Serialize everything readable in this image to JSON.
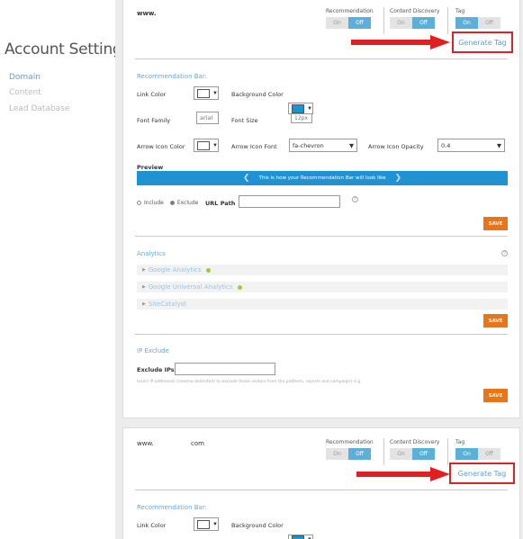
{
  "sidebar": {
    "title": "Account Settings",
    "items": [
      {
        "label": "Domain",
        "active": true
      },
      {
        "label": "Content",
        "active": false
      },
      {
        "label": "Lead Database",
        "active": false
      }
    ]
  },
  "colors": {
    "accent": "#5bb0d9",
    "save": "#e8751a",
    "annotation_red": "#d2242a",
    "preview_bar": "#1f93d1"
  },
  "domains": [
    {
      "name": "www.",
      "toggles": [
        {
          "label": "Recommendation",
          "on": "On",
          "off": "Off",
          "state": "off"
        },
        {
          "label": "Content Discovery",
          "on": "On",
          "off": "Off",
          "state": "off"
        },
        {
          "label": "Tag",
          "on": "On",
          "off": "Off",
          "state": "on"
        }
      ],
      "generate_tag": "Generate Tag",
      "recommendation_bar": {
        "title": "Recommendation Bar:",
        "link_color": "Link Color",
        "background_color": "Background Color",
        "font_family": "Font Family",
        "font_family_value": "arial",
        "font_size": "Font Size",
        "font_size_value": "12px",
        "arrow_icon_color": "Arrow Icon Color",
        "arrow_icon_font": "Arrow Icon Font",
        "arrow_icon_font_value": "fa-chevron",
        "arrow_icon_opacity": "Arrow Icon Opacity",
        "arrow_icon_opacity_value": "0.4",
        "preview": "Preview",
        "preview_text": "This is how your Recommendation Bar will look like",
        "include": "Include",
        "exclude": "Exclude",
        "url_path": "URL Path",
        "save": "SAVE"
      },
      "analytics": {
        "title": "Analytics",
        "items": [
          "Google Analytics",
          "Google Universal Analytics",
          "SiteCatalyst"
        ],
        "save": "SAVE"
      },
      "ip_exclude": {
        "title": "IP Exclude",
        "label": "Exclude IPs",
        "hint": "Insert IP addresses (comma-delimited) to exclude these visitors from the platform, reports and campaigns e.g.",
        "save": "SAVE"
      }
    },
    {
      "name": "www.",
      "name_suffix": "com",
      "toggles": [
        {
          "label": "Recommendation",
          "on": "On",
          "off": "Off",
          "state": "off"
        },
        {
          "label": "Content Discovery",
          "on": "On",
          "off": "Off",
          "state": "off"
        },
        {
          "label": "Tag",
          "on": "On",
          "off": "Off",
          "state": "on"
        }
      ],
      "generate_tag": "Generate Tag",
      "recommendation_bar": {
        "title": "Recommendation Bar:",
        "link_color": "Link Color",
        "background_color": "Background Color"
      }
    }
  ]
}
